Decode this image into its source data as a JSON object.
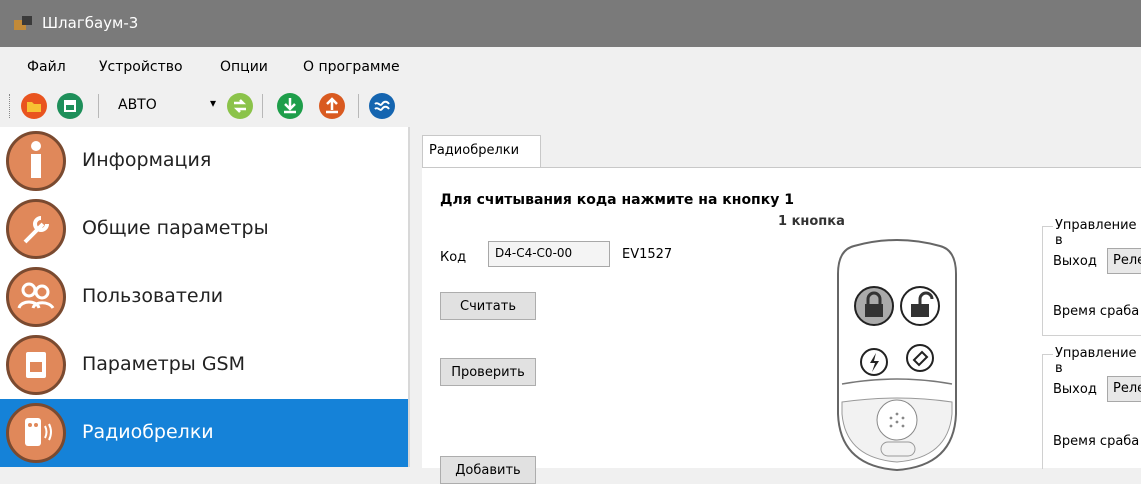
{
  "window": {
    "title": "Шлагбаум-3"
  },
  "menu": [
    "Файл",
    "Устройство",
    "Опции",
    "О программе"
  ],
  "toolbar": {
    "mode_value": "АВТО"
  },
  "sidebar": {
    "items": [
      {
        "label": "Информация",
        "icon": "info-icon"
      },
      {
        "label": "Общие параметры",
        "icon": "wrench-icon"
      },
      {
        "label": "Пользователи",
        "icon": "users-icon"
      },
      {
        "label": "Параметры GSM",
        "icon": "sim-card-icon"
      },
      {
        "label": "Радиобрелки",
        "icon": "remote-icon",
        "active": true
      }
    ]
  },
  "tabs": [
    {
      "label": "Радиобрелки"
    }
  ],
  "panel": {
    "heading": "Для считывания кода нажмите на кнопку 1",
    "fob_caption": "1 кнопка",
    "code_label": "Код",
    "code_value": "D4-C4-C0-00",
    "protocol": "EV1527",
    "read_button": "Считать",
    "check_button": "Проверить",
    "add_button": "Добавить"
  },
  "groups": [
    {
      "title": "Управление в",
      "output_label": "Выход",
      "output_value": "Реле",
      "time_label": "Время сраба"
    },
    {
      "title": "Управление в",
      "output_label": "Выход",
      "output_value": "Реле",
      "time_label": "Время сраба"
    }
  ],
  "colors": {
    "accent": "#1582d8",
    "titlebar": "#7a7a7a",
    "nav_icon": "#e0885a"
  }
}
